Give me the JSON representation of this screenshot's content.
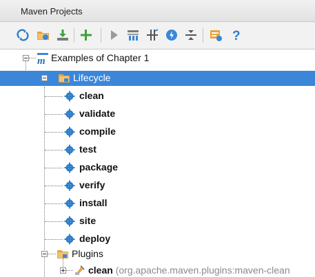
{
  "panel": {
    "title": "Maven Projects"
  },
  "colors": {
    "selection": "#3b86d9",
    "gear": "#2f7ec9",
    "plus": "#3aa23a",
    "help": "#2f7ec9"
  },
  "toolbar": {
    "icons": [
      "refresh-icon",
      "generate-sources-icon",
      "download-icon",
      "add-icon",
      "run-icon",
      "execute-goal-icon",
      "toggle-offline-icon",
      "skip-tests-icon",
      "collapse-all-icon",
      "settings-icon",
      "help-icon"
    ]
  },
  "tree": {
    "project": {
      "label": "Examples of Chapter 1"
    },
    "lifecycle": {
      "label": "Lifecycle",
      "phases": [
        "clean",
        "validate",
        "compile",
        "test",
        "package",
        "verify",
        "install",
        "site",
        "deploy"
      ]
    },
    "plugins": {
      "label": "Plugins",
      "first_plugin": {
        "name": "clean",
        "detail": "(org.apache.maven.plugins:maven-clean"
      }
    }
  }
}
